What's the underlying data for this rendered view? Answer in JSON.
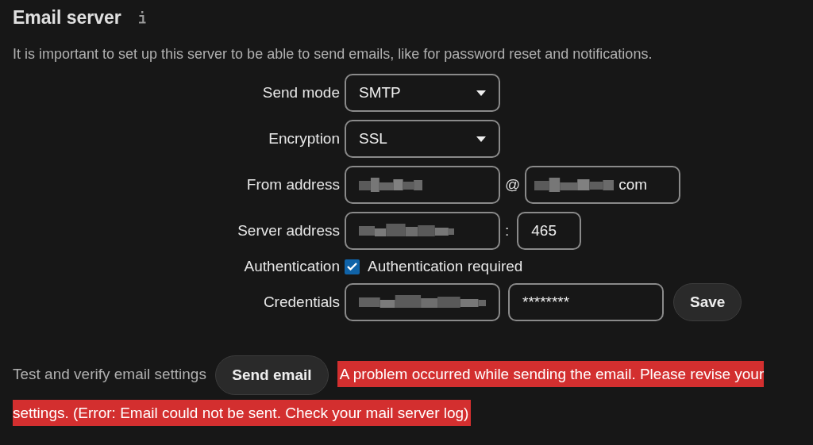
{
  "section": {
    "title": "Email server",
    "description": "It is important to set up this server to be able to send emails, like for password reset and notifications."
  },
  "form": [
    {
      "label": "Send mode",
      "controls": [
        {
          "kind": "select",
          "value": "SMTP"
        }
      ]
    },
    {
      "label": "Encryption",
      "controls": [
        {
          "kind": "select",
          "value": "SSL"
        }
      ]
    },
    {
      "label": "From address",
      "controls": [
        {
          "kind": "redacted-input"
        },
        {
          "kind": "separator",
          "text": "@"
        },
        {
          "kind": "redacted-input",
          "value": "com"
        }
      ]
    },
    {
      "label": "Server address",
      "controls": [
        {
          "kind": "redacted-input"
        },
        {
          "kind": "separator",
          "text": ":"
        },
        {
          "kind": "port-input",
          "value": "465"
        }
      ]
    },
    {
      "label": "Authentication",
      "controls": [
        {
          "kind": "checkbox",
          "checked": true,
          "text": "Authentication required"
        }
      ]
    },
    {
      "label": "Credentials",
      "controls": [
        {
          "kind": "redacted-input"
        },
        {
          "kind": "password-input",
          "value": "********"
        },
        {
          "kind": "button",
          "text": "Save"
        }
      ]
    }
  ],
  "test": {
    "label": "Test and verify email settings",
    "button": "Send email",
    "error": "A problem occurred while sending the email. Please revise your settings. (Error: Email could not be sent. Check your mail server log)"
  }
}
